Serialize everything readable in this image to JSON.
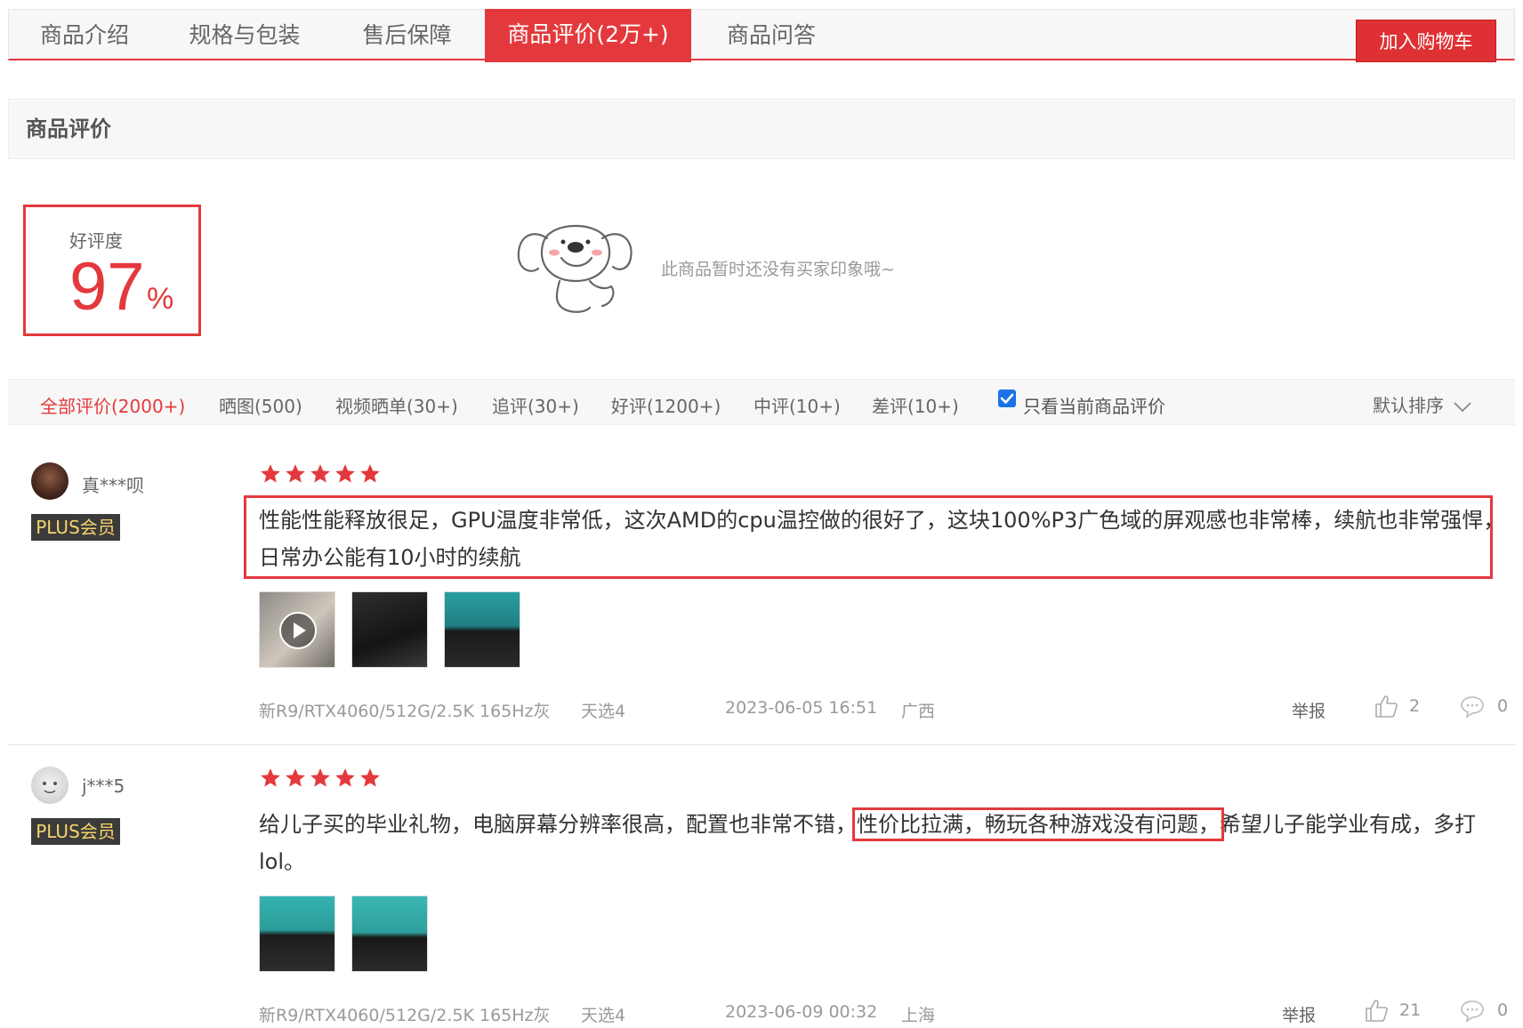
{
  "tabs": [
    "商品介绍",
    "规格与包装",
    "售后保障",
    "商品评价(2万+)",
    "商品问答"
  ],
  "cart_button": "加入购物车",
  "section_title": "商品评价",
  "rating": {
    "label": "好评度",
    "value": "97",
    "unit": "%"
  },
  "no_impression": "此商品暂时还没有买家印象哦~",
  "filters": [
    "全部评价(2000+)",
    "晒图(500)",
    "视频晒单(30+)",
    "追评(30+)",
    "好评(1200+)",
    "中评(10+)",
    "差评(10+)"
  ],
  "only_current": {
    "label": "只看当前商品评价",
    "checked": true
  },
  "sort_label": "默认排序",
  "reviews": [
    {
      "user": "真***呗",
      "badge": "PLUS会员",
      "stars": 5,
      "content_line1": "性能性能释放很足，GPU温度非常低，这次AMD的cpu温控做的很好了，这块100%P3广色域的屏观感也非常棒，续航也非常强悍，",
      "content_line2": "日常办公能有10小时的续航",
      "spec": "新R9/RTX4060/512G/2.5K 165Hz灰",
      "model": "天选4",
      "date": "2023-06-05 16:51",
      "region": "广西",
      "report": "举报",
      "likes": "2",
      "comments": "0"
    },
    {
      "user": "j***5",
      "badge": "PLUS会员",
      "stars": 5,
      "content_pre": "给儿子买的毕业礼物，电脑屏幕分辨率很高，配置也非常不错，",
      "content_hl": "性价比拉满，畅玩各种游戏没有问题，",
      "content_post": "希望儿子能学业有成，多打",
      "content_line2": "lol。",
      "spec": "新R9/RTX4060/512G/2.5K 165Hz灰",
      "model": "天选4",
      "date": "2023-06-09 00:32",
      "region": "上海",
      "report": "举报",
      "likes": "21",
      "comments": "0"
    }
  ],
  "colors": {
    "accent": "#e4393c",
    "plus_bg": "#3b3b3b",
    "plus_text": "#f5d46b"
  }
}
